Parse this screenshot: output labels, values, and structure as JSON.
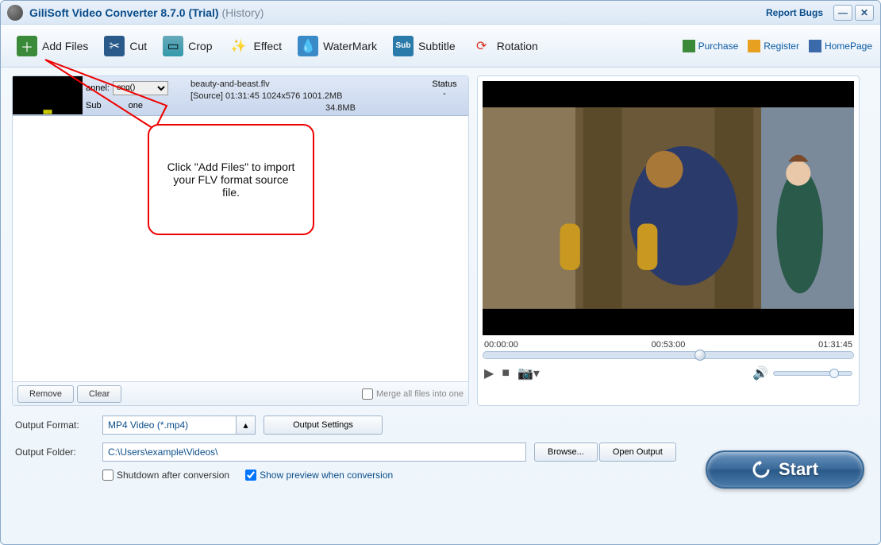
{
  "title": {
    "main": "GiliSoft Video Converter 8.7.0 (Trial)",
    "sub": "(History)"
  },
  "report_bugs": "Report Bugs",
  "toolbar": {
    "add_files": "Add Files",
    "cut": "Cut",
    "crop": "Crop",
    "effect": "Effect",
    "watermark": "WaterMark",
    "subtitle": "Subtitle",
    "rotation": "Rotation"
  },
  "links": {
    "purchase": "Purchase",
    "register": "Register",
    "homepage": "HomePage"
  },
  "file": {
    "channel_label": "annel:",
    "channel_value": "eng()",
    "subtitle_label": "Sub",
    "subtitle_value": "one",
    "filename": "beauty-and-beast.flv",
    "source_line": "[Source]  01:31:45  1024x576  1001.2MB",
    "target_line": "34.8MB",
    "status_header": "Status",
    "status_value": "-"
  },
  "bottom": {
    "remove": "Remove",
    "clear": "Clear",
    "merge": "Merge all files into one"
  },
  "preview": {
    "times": {
      "start": "00:00:00",
      "mid": "00:53:00",
      "end": "01:31:45"
    },
    "pos_percent": 57
  },
  "output": {
    "format_label": "Output Format:",
    "format_value": "MP4 Video (*.mp4)",
    "settings": "Output Settings",
    "folder_label": "Output Folder:",
    "folder_value": "C:\\Users\\example\\Videos\\",
    "browse": "Browse...",
    "open_output": "Open Output"
  },
  "start": "Start",
  "checks": {
    "shutdown": "Shutdown after conversion",
    "preview": "Show preview when conversion"
  },
  "callout": "Click \"Add Files\" to import your FLV format source file."
}
